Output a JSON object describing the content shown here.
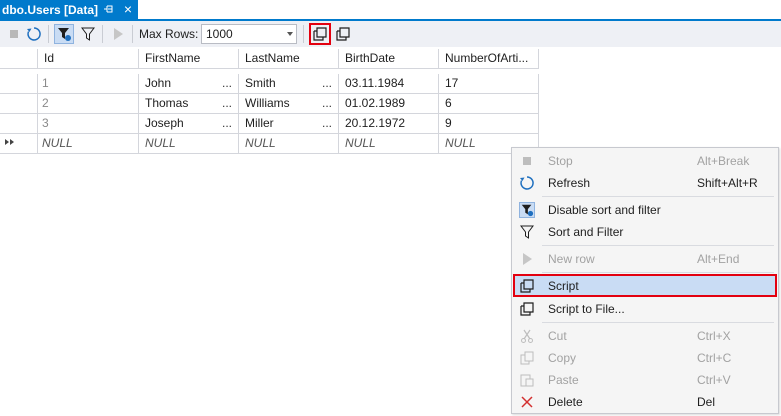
{
  "tab": {
    "title": "dbo.Users [Data]",
    "pin_icon": "pin-icon",
    "close_glyph": "×"
  },
  "toolbar": {
    "max_rows_label": "Max Rows:",
    "max_rows_value": "1000",
    "highlight_color": "#e3000f"
  },
  "grid": {
    "columns": [
      "Id",
      "FirstName",
      "LastName",
      "BirthDate",
      "NumberOfArti..."
    ],
    "rows": [
      {
        "id": "1",
        "first": "John",
        "last": "Smith",
        "birth": "03.11.1984",
        "articles": "17"
      },
      {
        "id": "2",
        "first": "Thomas",
        "last": "Williams",
        "birth": "01.02.1989",
        "articles": "6"
      },
      {
        "id": "3",
        "first": "Joseph",
        "last": "Miller",
        "birth": "20.12.1972",
        "articles": "9"
      }
    ],
    "new_row": {
      "id": "NULL",
      "first": "NULL",
      "last": "NULL",
      "birth": "NULL",
      "articles": "NULL"
    },
    "ellipsis": "..."
  },
  "context_menu": {
    "items": [
      {
        "label": "Stop",
        "shortcut": "Alt+Break",
        "icon": "stop-icon",
        "enabled": false
      },
      {
        "label": "Refresh",
        "shortcut": "Shift+Alt+R",
        "icon": "refresh-icon",
        "enabled": true
      },
      {
        "label": "Disable sort and filter",
        "shortcut": "",
        "icon": "disable-filter-icon",
        "enabled": true
      },
      {
        "label": "Sort and Filter",
        "shortcut": "",
        "icon": "filter-icon",
        "enabled": true
      },
      {
        "label": "New row",
        "shortcut": "Alt+End",
        "icon": "new-row-icon",
        "enabled": false
      },
      {
        "label": "Script",
        "shortcut": "",
        "icon": "script-icon",
        "enabled": true,
        "selected": true
      },
      {
        "label": "Script to File...",
        "shortcut": "",
        "icon": "script-to-file-icon",
        "enabled": true
      },
      {
        "label": "Cut",
        "shortcut": "Ctrl+X",
        "icon": "cut-icon",
        "enabled": false
      },
      {
        "label": "Copy",
        "shortcut": "Ctrl+C",
        "icon": "copy-icon",
        "enabled": false
      },
      {
        "label": "Paste",
        "shortcut": "Ctrl+V",
        "icon": "paste-icon",
        "enabled": false
      },
      {
        "label": "Delete",
        "shortcut": "Del",
        "icon": "delete-icon",
        "enabled": true
      }
    ],
    "selection_color": "#c9dcf4"
  }
}
